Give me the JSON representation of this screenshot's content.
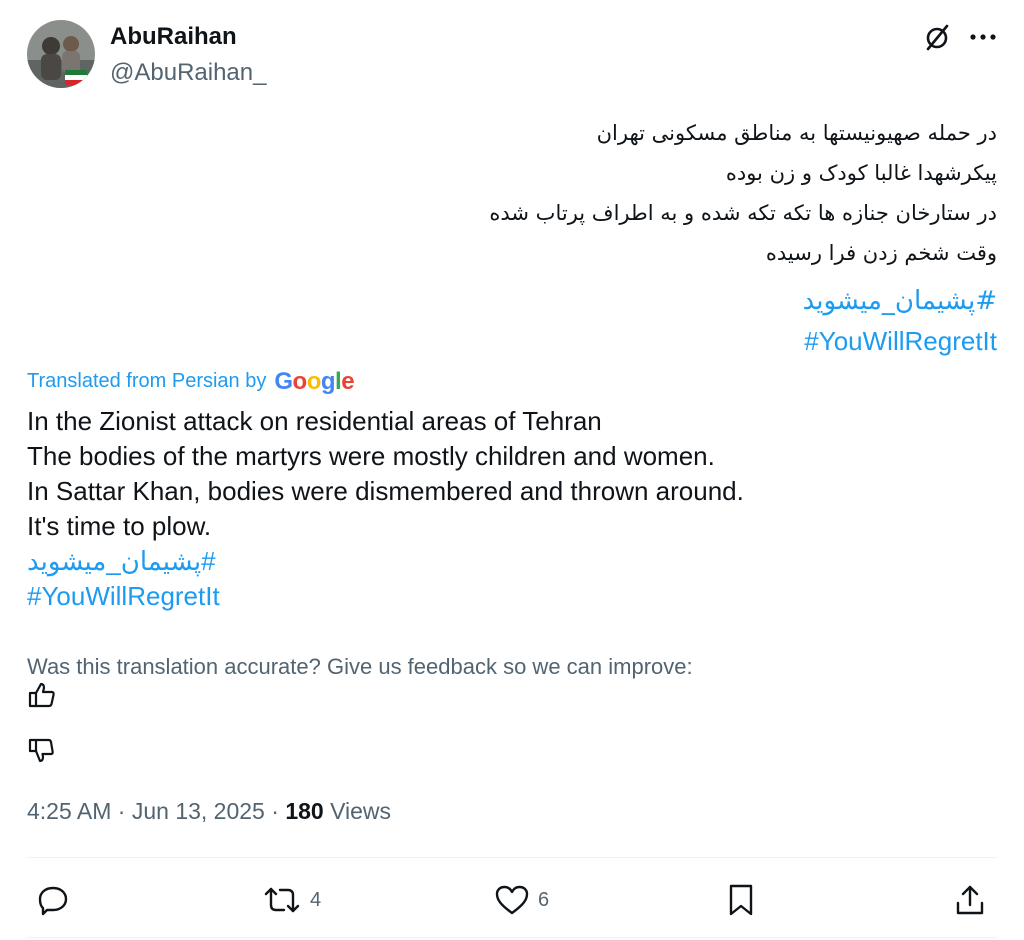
{
  "author": {
    "name": "AbuRaihan",
    "handle": "@AbuRaihan_"
  },
  "tweet": {
    "lines_fa": [
      "در حمله صهیونیستها  به مناطق مسکونی تهران",
      "پیکرشهدا غالبا کودک و زن بوده",
      "در ستارخان جنازه ها تکه تکه شده و به اطراف  پرتاب شده",
      "وقت شخم زدن فرا رسیده"
    ],
    "hashtag_fa": "#پشیمان_میشوید",
    "hashtag_en": "#YouWillRegretIt"
  },
  "translation": {
    "label": "Translated from Persian by",
    "provider": "Google",
    "lines": [
      "In the Zionist attack on residential areas of Tehran",
      "The bodies of the martyrs were mostly children and women.",
      "In Sattar Khan, bodies were dismembered and thrown around.",
      "It's time to plow."
    ],
    "hashtag_fa": "#پشیمان_میشوید",
    "hashtag_en": "#YouWillRegretIt",
    "feedback": "Was this translation accurate? Give us feedback so we can improve:"
  },
  "meta": {
    "time": "4:25 AM",
    "date": "Jun 13, 2025",
    "sep": "·",
    "views_count": "180",
    "views_label": "Views"
  },
  "actions": {
    "reposts": "4",
    "likes": "6"
  },
  "icons": [
    "grok-icon",
    "more-icon",
    "thumbs-up-icon",
    "thumbs-down-icon",
    "reply-icon",
    "repost-icon",
    "like-icon",
    "bookmark-icon",
    "share-icon"
  ],
  "colors": {
    "link": "#1d9bf0",
    "secondary_text": "#536471",
    "primary_text": "#0f1419",
    "divider": "#eff3f4"
  }
}
